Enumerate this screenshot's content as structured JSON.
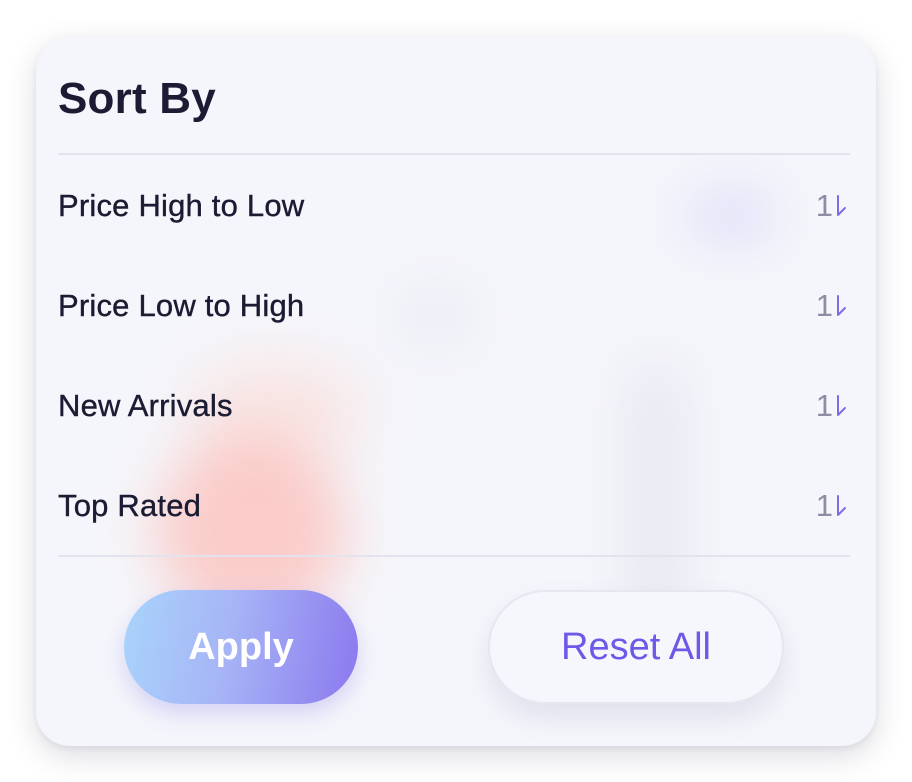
{
  "sheet": {
    "title": "Sort By"
  },
  "sort_options": [
    {
      "label": "Price High to Low",
      "icon": "sort-icon",
      "icon_text": "1"
    },
    {
      "label": "Price Low to High",
      "icon": "sort-icon",
      "icon_text": "1"
    },
    {
      "label": "New Arrivals",
      "icon": "sort-icon",
      "icon_text": "1"
    },
    {
      "label": "Top Rated",
      "icon": "sort-icon",
      "icon_text": "1"
    }
  ],
  "actions": {
    "apply_label": "Apply",
    "reset_label": "Reset All"
  },
  "colors": {
    "accent": "#6b5ae8",
    "text_primary": "#1b1c33",
    "icon_gray": "#8b8ea3",
    "sort_arrow": "#7a6ee8"
  }
}
